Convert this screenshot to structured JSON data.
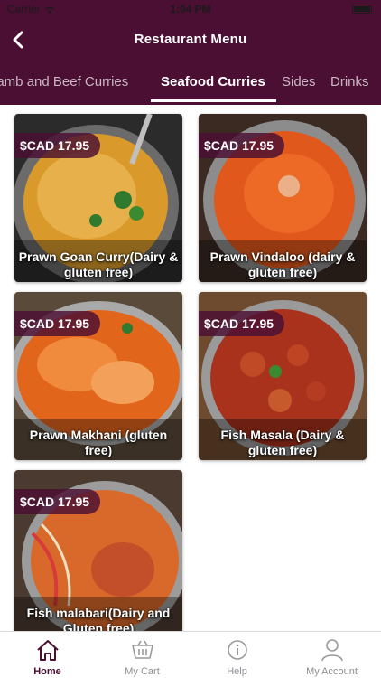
{
  "statusbar": {
    "carrier": "Carrier",
    "time": "1:04 PM"
  },
  "header": {
    "title": "Restaurant Menu",
    "back_icon": "chevron-left-icon"
  },
  "tabs": [
    {
      "label": "Lamb and Beef Curries",
      "active": false
    },
    {
      "label": "Seafood Curries",
      "active": true
    },
    {
      "label": "Sides",
      "active": false
    },
    {
      "label": "Drinks",
      "active": false
    }
  ],
  "items": [
    {
      "name": "Prawn Goan Curry(Dairy & gluten free)",
      "price": "$CAD 17.95"
    },
    {
      "name": "Prawn Vindaloo (dairy & gluten free)",
      "price": "$CAD 17.95"
    },
    {
      "name": "Prawn Makhani (gluten free)",
      "price": "$CAD 17.95"
    },
    {
      "name": "Fish Masala (Dairy & gluten free)",
      "price": "$CAD 17.95"
    },
    {
      "name": "Fish malabari(Dairy and Gluten free)",
      "price": "$CAD 17.95"
    }
  ],
  "tabbar": [
    {
      "label": "Home",
      "icon": "home-icon",
      "active": true
    },
    {
      "label": "My Cart",
      "icon": "cart-icon",
      "active": false
    },
    {
      "label": "Help",
      "icon": "info-icon",
      "active": false
    },
    {
      "label": "My Account",
      "icon": "user-icon",
      "active": false
    }
  ],
  "colors": {
    "brand": "#4a0f33",
    "tab_inactive": "#c9b7c2",
    "tabbar_inactive": "#8e8e93"
  }
}
